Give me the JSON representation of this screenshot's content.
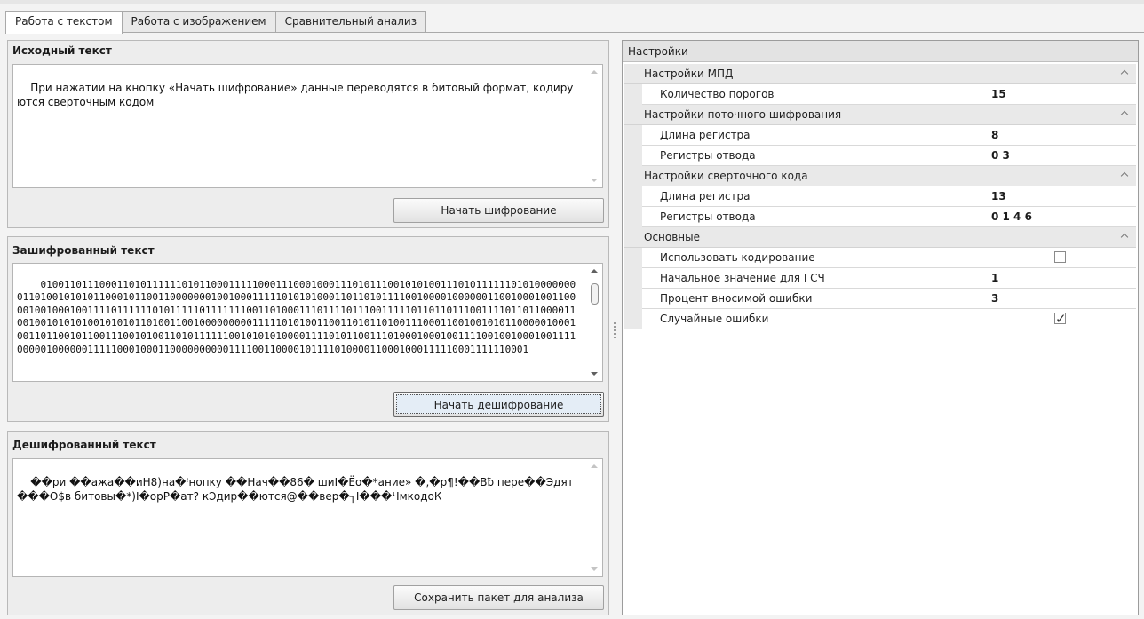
{
  "tabs": [
    {
      "label": "Работа с текстом"
    },
    {
      "label": "Работа с изображением"
    },
    {
      "label": "Сравнительный анализ"
    }
  ],
  "source": {
    "title": "Исходный текст",
    "text": "При нажатии на кнопку «Начать шифрование» данные переводятся в битовый формат, кодируются сверточным кодом",
    "button": "Начать шифрование"
  },
  "encrypted": {
    "title": "Зашифрованный текст",
    "text": "010011011100011010111111010110001111100011100010001110101110010101001110101111110101000000001101001010101100010110011000000010010001111101010100011011010111100100001000000110010001001100001001000100111101111110101111101111111001101000111011110111001111101101101110011110110110000110010010101010010101011010011001000000000111110101001100110101101001110001100100101011000001000100110110010110011100101001101011111100101010100001111010110011101000100010011110010010001001111000001000000111110001000110000000000111100110000101111010000110001000111110001111110001",
    "button": "Начать дешифрование"
  },
  "decrypted": {
    "title": "Дешифрованный текст",
    "text": "��ри ��ажа��иН8)на�ꜝнопку ��Нач��86� шиІ�Ёо�*ание» �,�р¶!��Вƀ пере��Эдят���О$в битовы�*)І�орР�ат? кЭдир��ются@��вер�┐І���ЧмкодоК",
    "button": "Сохранить пакет для анализа"
  },
  "settings": {
    "header": "Настройки",
    "categories": [
      {
        "label": "Настройки МПД",
        "props": [
          {
            "name": "Количество порогов",
            "value": "15"
          }
        ]
      },
      {
        "label": "Настройки поточного шифрования",
        "props": [
          {
            "name": "Длина регистра",
            "value": "8"
          },
          {
            "name": "Регистры отвода",
            "value": "0 3"
          }
        ]
      },
      {
        "label": "Настройки сверточного кода",
        "props": [
          {
            "name": "Длина регистра",
            "value": "13"
          },
          {
            "name": "Регистры отвода",
            "value": "0 1 4 6"
          }
        ]
      },
      {
        "label": "Основные",
        "props": [
          {
            "name": "Использовать кодирование",
            "checked": false
          },
          {
            "name": "Начальное значение для ГСЧ",
            "value": "1"
          },
          {
            "name": "Процент вносимой ошибки",
            "value": "3"
          },
          {
            "name": "Случайные ошибки",
            "checked": true
          }
        ]
      }
    ]
  }
}
